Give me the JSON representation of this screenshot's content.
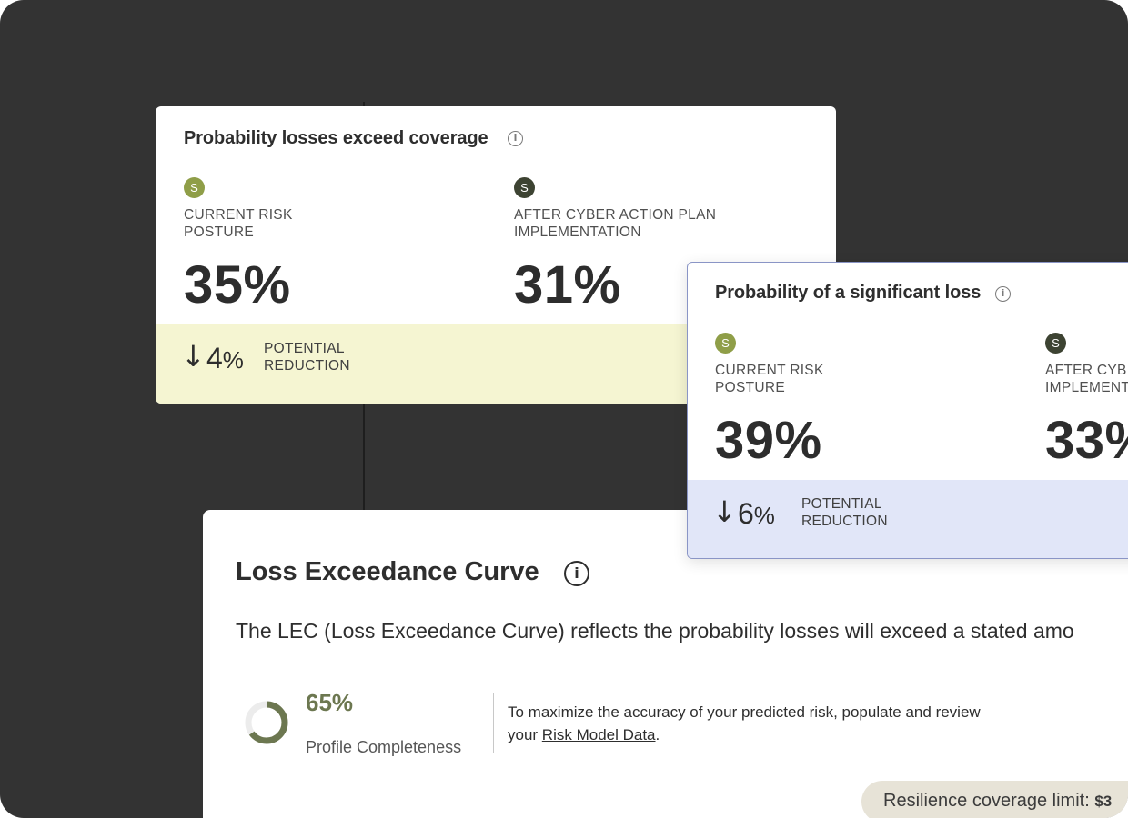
{
  "card_coverage": {
    "title": "Probability losses exceed coverage",
    "info_icon": "info-icon",
    "current": {
      "badge": "S",
      "label_line1": "CURRENT RISK",
      "label_line2": "POSTURE",
      "value": "35%"
    },
    "after": {
      "badge": "S",
      "label_line1": "AFTER CYBER ACTION PLAN",
      "label_line2": "IMPLEMENTATION",
      "value": "31%"
    },
    "reduction": {
      "arrow": "↓",
      "number": "4",
      "unit": "%",
      "label_line1": "POTENTIAL",
      "label_line2": "REDUCTION"
    },
    "colors": {
      "band": "#f5f5d2",
      "badge_current": "#8f9e48",
      "badge_after": "#3d4332"
    }
  },
  "card_significant": {
    "title": "Probability of a significant loss",
    "info_icon": "info-icon",
    "current": {
      "badge": "S",
      "label_line1": "CURRENT RISK",
      "label_line2": "POSTURE",
      "value": "39%"
    },
    "after": {
      "badge": "S",
      "label_line1": "AFTER CYB",
      "label_line2": "IMPLEMENT",
      "value": "33%"
    },
    "reduction": {
      "arrow": "↓",
      "number": "6",
      "unit": "%",
      "label_line1": "POTENTIAL",
      "label_line2": "REDUCTION"
    },
    "colors": {
      "band": "#e1e6f8",
      "border": "#8a95c6"
    }
  },
  "lec": {
    "title": "Loss Exceedance Curve",
    "description": "The LEC (Loss Exceedance Curve) reflects the probability losses will exceed a stated amo",
    "profile": {
      "value": "65%",
      "progress_fraction": 0.65,
      "label": "Profile Completeness",
      "ring_color": "#6c7750"
    },
    "hint": {
      "text_before": "To maximize the accuracy of your predicted risk, populate and review your ",
      "link": "Risk Model Data",
      "text_after": "."
    },
    "coverage_pill": {
      "label": "Resilience coverage limit: ",
      "amount": "$3"
    }
  }
}
